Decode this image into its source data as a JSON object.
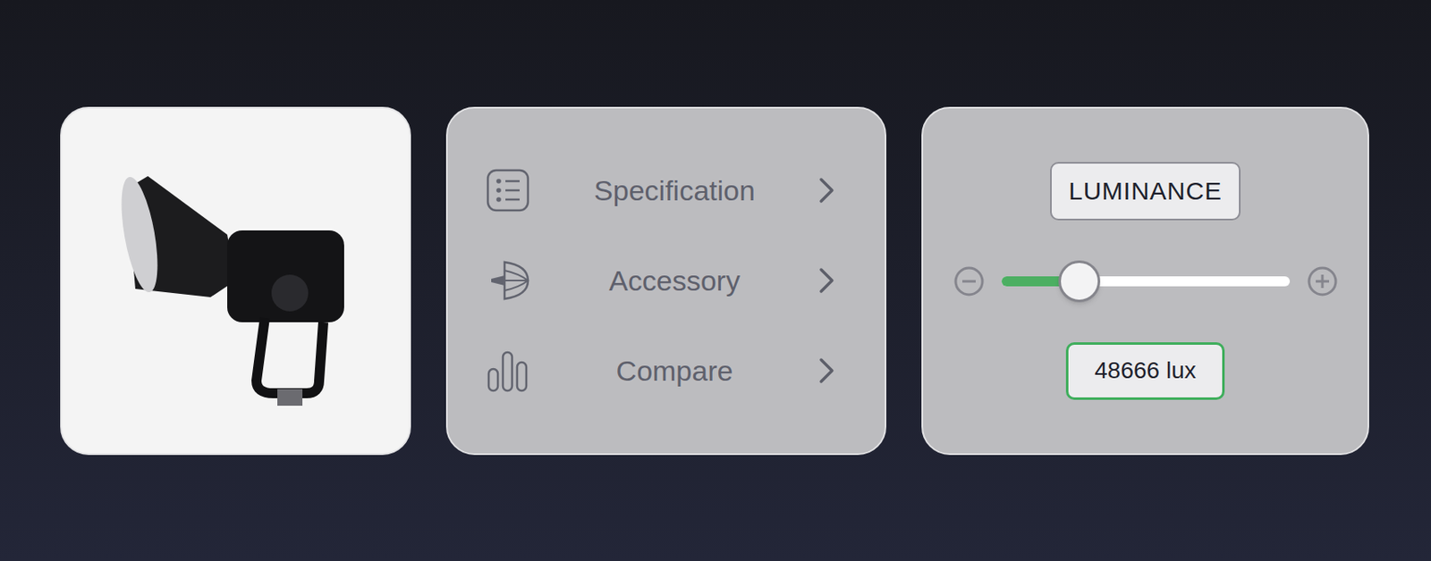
{
  "menu": [
    {
      "label": "Specification"
    },
    {
      "label": "Accessory"
    },
    {
      "label": "Compare"
    }
  ],
  "luminance": {
    "label": "LUMINANCE",
    "level": 0.27,
    "reading": "48666 lux"
  }
}
